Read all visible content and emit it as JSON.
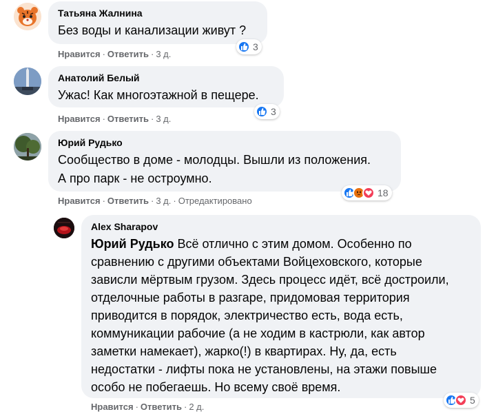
{
  "comments": [
    {
      "author": "Татьяна Жалнина",
      "text": "Без воды и канализации живут ?",
      "reaction_count": "3",
      "reactions": [
        "like"
      ],
      "like_label": "Нравится",
      "reply_label": "Ответить",
      "time": "3 д."
    },
    {
      "author": "Анатолий Белый",
      "text": "Ужас! Как многоэтажной в пещере.",
      "reaction_count": "3",
      "reactions": [
        "like"
      ],
      "like_label": "Нравится",
      "reply_label": "Ответить",
      "time": "3 д."
    },
    {
      "author": "Юрий Рудько",
      "text_lines": [
        "Сообщество в доме - молодцы. Вышли из положения.",
        "А про парк - не остроумно."
      ],
      "reaction_count": "18",
      "reactions": [
        "like",
        "angry",
        "love"
      ],
      "like_label": "Нравится",
      "reply_label": "Ответить",
      "time": "3 д.",
      "edited_label": "Отредактировано"
    },
    {
      "author": "Alex Sharapov",
      "mention": "Юрий Рудько",
      "text_lines": [
        "Всё отлично с этим домом. Особенно по",
        "сравнению с другими объектами Войцеховского, которые",
        "зависли мёртвым грузом. Здесь процесс идёт, всё достроили,",
        "отделочные работы в разгаре, придомовая территория",
        "приводится в порядок, электричество есть, вода есть,",
        "коммуникации рабочие (а не ходим в кастрюли, как автор",
        "заметки намекает), жарко(!) в квартирах. Ну, да, есть",
        "недостатки - лифты пока не установлены, на этажи повыше",
        "особо не побегаешь. Но всему своё время."
      ],
      "reaction_count": "5",
      "reactions": [
        "like",
        "love"
      ],
      "like_label": "Нравится",
      "reply_label": "Ответить",
      "time": "2 д."
    }
  ],
  "colors": {
    "like": "#1877f2",
    "love": "#f33e58",
    "angry": "#e9710f",
    "bubble": "#f0f2f5",
    "meta": "#65676b"
  }
}
